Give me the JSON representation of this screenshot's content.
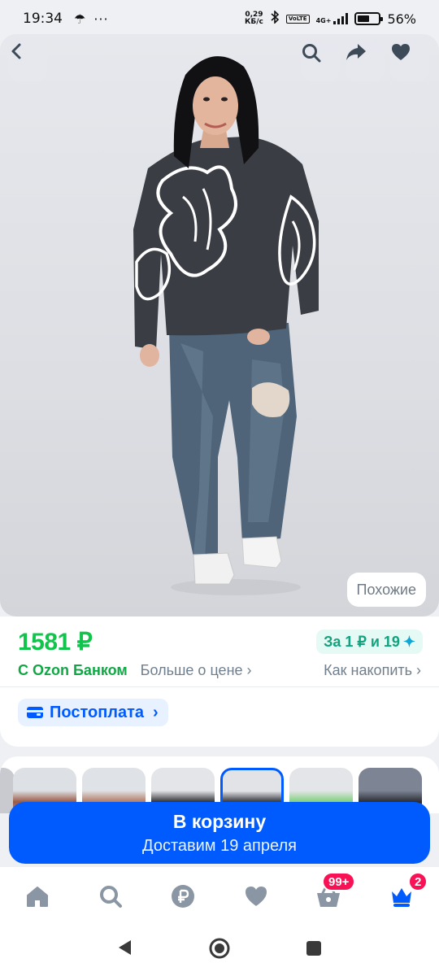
{
  "status_bar": {
    "time": "19:34",
    "umbrella_icon": "umbrella-icon",
    "more": "···",
    "net_speed_line1": "0,29",
    "net_speed_line2": "КБ/с",
    "volte": "VoLTE",
    "network": "4G+",
    "battery_level": 0.56,
    "battery_text": "56%"
  },
  "header": {
    "back_icon": "back-arrow-icon",
    "search_icon": "search-icon",
    "share_icon": "share-icon",
    "favorite_icon": "heart-icon",
    "similar_label": "Похожие"
  },
  "price_block": {
    "price": "1581 ₽",
    "cashback": "За 1 ₽ и 19",
    "cashback_icon": "sparkle-icon",
    "ozon_bank": "С Ozon Банком",
    "more_about_price": "Больше о цене ›",
    "how_to_save": "Как накопить ›"
  },
  "postpay": {
    "label": "Постоплата",
    "icon": "wallet-icon",
    "arrow": "›"
  },
  "cart": {
    "button_label": "В корзину",
    "delivery_text": "Доставим 19 апреля"
  },
  "bottom_nav": {
    "items": [
      {
        "name": "home",
        "icon": "home-icon"
      },
      {
        "name": "search",
        "icon": "search-icon"
      },
      {
        "name": "ozon-bank",
        "icon": "ruble-icon"
      },
      {
        "name": "favorites",
        "icon": "heart-icon"
      },
      {
        "name": "cart",
        "icon": "basket-icon",
        "badge": "99+"
      },
      {
        "name": "my-ozon",
        "icon": "crown-icon",
        "badge": "2"
      }
    ]
  },
  "android_nav": {
    "back": "triangle-back-icon",
    "home": "circle-home-icon",
    "recents": "square-recents-icon"
  },
  "colors": {
    "accent": "#005bff",
    "price_green": "#10c44c",
    "badge_pink": "#f91155"
  }
}
